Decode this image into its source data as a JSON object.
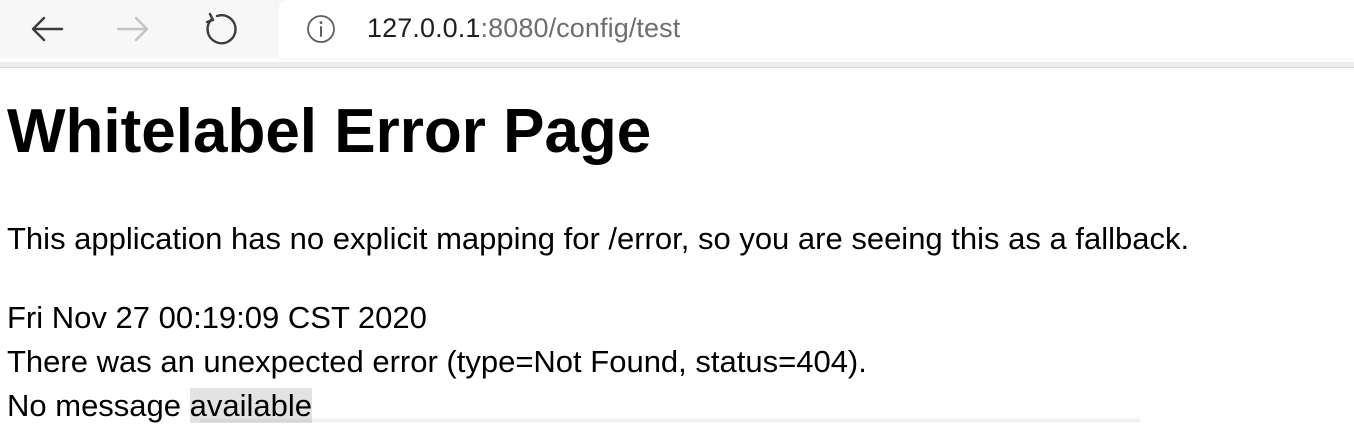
{
  "browser": {
    "back_icon": "arrow-left-icon",
    "forward_icon": "arrow-right-icon",
    "reload_icon": "reload-icon",
    "info_icon": "info-circle-icon",
    "url_host": "127.0.0.1",
    "url_rest": ":8080/config/test"
  },
  "page": {
    "title": "Whitelabel Error Page",
    "description": "This application has no explicit mapping for /error, so you are seeing this as a fallback.",
    "timestamp": "Fri Nov 27 00:19:09 CST 2020",
    "error_line": "There was an unexpected error (type=Not Found, status=404).",
    "message_prefix": "No message ",
    "message_highlight": "available"
  },
  "colors": {
    "toolbar_bg": "#f7f7f7",
    "url_host": "#1f1f1f",
    "url_rest": "#6e6e6e",
    "icon_active": "#3c3c3c",
    "icon_disabled": "#c4c4c4",
    "selection_highlight": "#e3e3e3"
  }
}
